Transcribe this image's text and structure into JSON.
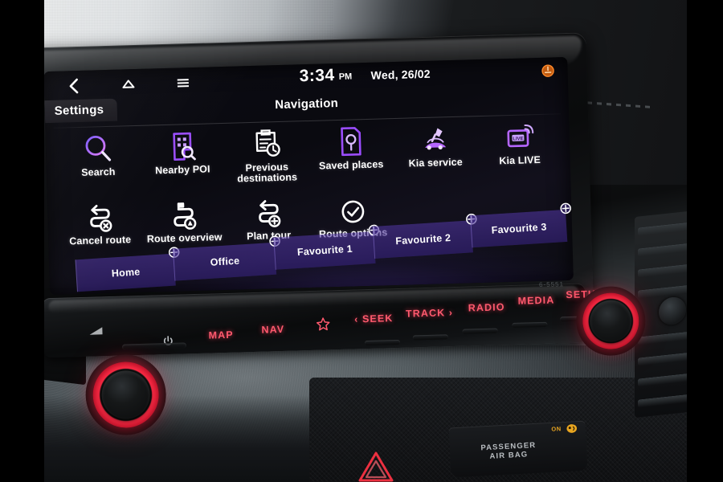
{
  "screen": {
    "statusbar": {
      "back_icon": "back-chevron-icon",
      "home_icon": "home-icon",
      "menu_icon": "menu-hamburger-icon",
      "time": "3:34",
      "ampm": "PM",
      "date": "Wed, 26/02",
      "warning_icon": "warning-indicator-icon"
    },
    "settings_tab": "Settings",
    "page_title": "Navigation",
    "menu_rows": [
      [
        {
          "label": "Search",
          "icon": "magnifier-icon",
          "color": "#c06cff"
        },
        {
          "label": "Nearby POI",
          "icon": "poi-building-search-icon",
          "color": "#9b4dff"
        },
        {
          "label": "Previous\ndestinations",
          "icon": "clipboard-clock-icon",
          "color": "#ffffff"
        },
        {
          "label": "Saved places",
          "icon": "map-pin-card-icon",
          "color": "#9b4dff"
        },
        {
          "label": "Kia service",
          "icon": "kia-service-wrench-icon",
          "color": "#b566ff"
        },
        {
          "label": "Kia LIVE",
          "icon": "kia-live-signal-icon",
          "color": "#b566ff"
        }
      ],
      [
        {
          "label": "Cancel route",
          "icon": "route-cancel-icon",
          "color": "#ffffff"
        },
        {
          "label": "Route overview",
          "icon": "route-overview-icon",
          "color": "#ffffff"
        },
        {
          "label": "Plan tour",
          "icon": "route-add-icon",
          "color": "#ffffff"
        },
        {
          "label": "Route options",
          "icon": "check-circle-icon",
          "color": "#ffffff"
        }
      ]
    ],
    "favourites": [
      {
        "label": "Home",
        "add_icon": "plus-circle-icon"
      },
      {
        "label": "Office",
        "add_icon": "plus-circle-icon"
      },
      {
        "label": "Favourite 1",
        "add_icon": "plus-circle-icon"
      },
      {
        "label": "Favourite 2",
        "add_icon": "plus-circle-icon"
      },
      {
        "label": "Favourite 3",
        "add_icon": "plus-circle-icon"
      }
    ]
  },
  "hardkeys": {
    "map": "MAP",
    "nav": "NAV",
    "favourite_icon": "star-icon",
    "seek": "‹ SEEK",
    "track": "TRACK ›",
    "radio": "RADIO",
    "media": "MEDIA",
    "setup": "SETUP",
    "power_icon": "power-icon",
    "eject_icon": "eject-triangle-icon",
    "unit_mark": "6-5551"
  },
  "knobs": {
    "left": "volume-power-knob",
    "right": "tune-knob"
  },
  "console": {
    "hazard_icon": "hazard-triangle-icon",
    "airbag_line1": "PASSENGER",
    "airbag_line2": "AIR BAG",
    "airbag_status": "ON",
    "airbag_lamp_icon": "airbag-lamp-icon"
  },
  "colors": {
    "key_red": "#ff5a6e",
    "knob_red": "#ff2b45",
    "accent_purple": "#9b4dff",
    "screen_bg": "#0b0b12"
  }
}
